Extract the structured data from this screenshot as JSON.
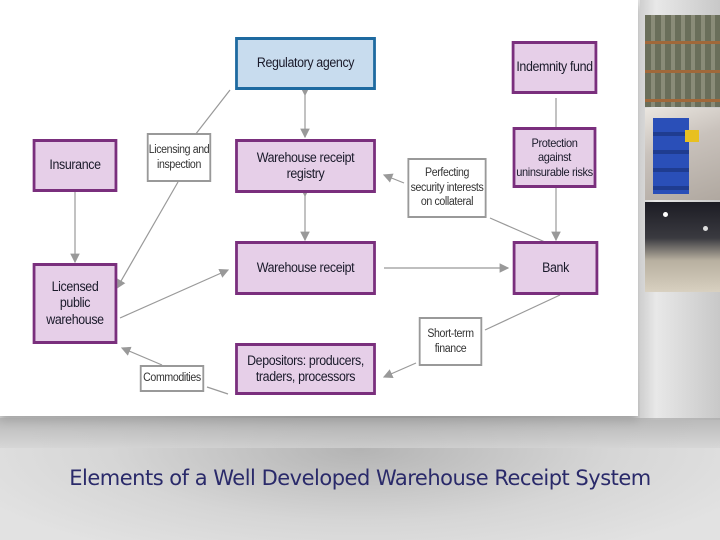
{
  "diagram": {
    "nodes": {
      "regulatory_agency": "Regulatory agency",
      "indemnity_fund": "Indemnity fund",
      "insurance": "Insurance",
      "licensing_inspection": "Licensing and inspection",
      "warehouse_receipt_registry": "Warehouse receipt registry",
      "perfecting_security": "Perfecting security interests on collateral",
      "protection_risks": "Protection against uninsurable risks",
      "warehouse_receipt": "Warehouse receipt",
      "bank": "Bank",
      "licensed_public_warehouse": "Licensed public warehouse",
      "short_term_finance": "Short-term finance",
      "depositors": "Depositors: producers, traders, processors",
      "commodities": "Commodities"
    },
    "colors": {
      "primary_fill": "#e6cfe8",
      "primary_border": "#7a2f7d",
      "regulator_fill": "#c8dcee",
      "regulator_border": "#1e6aa0",
      "connector": "#999999"
    }
  },
  "slide": {
    "title": "Elements of a Well Developed Warehouse Receipt System",
    "title_color": "#2a2a6a"
  }
}
